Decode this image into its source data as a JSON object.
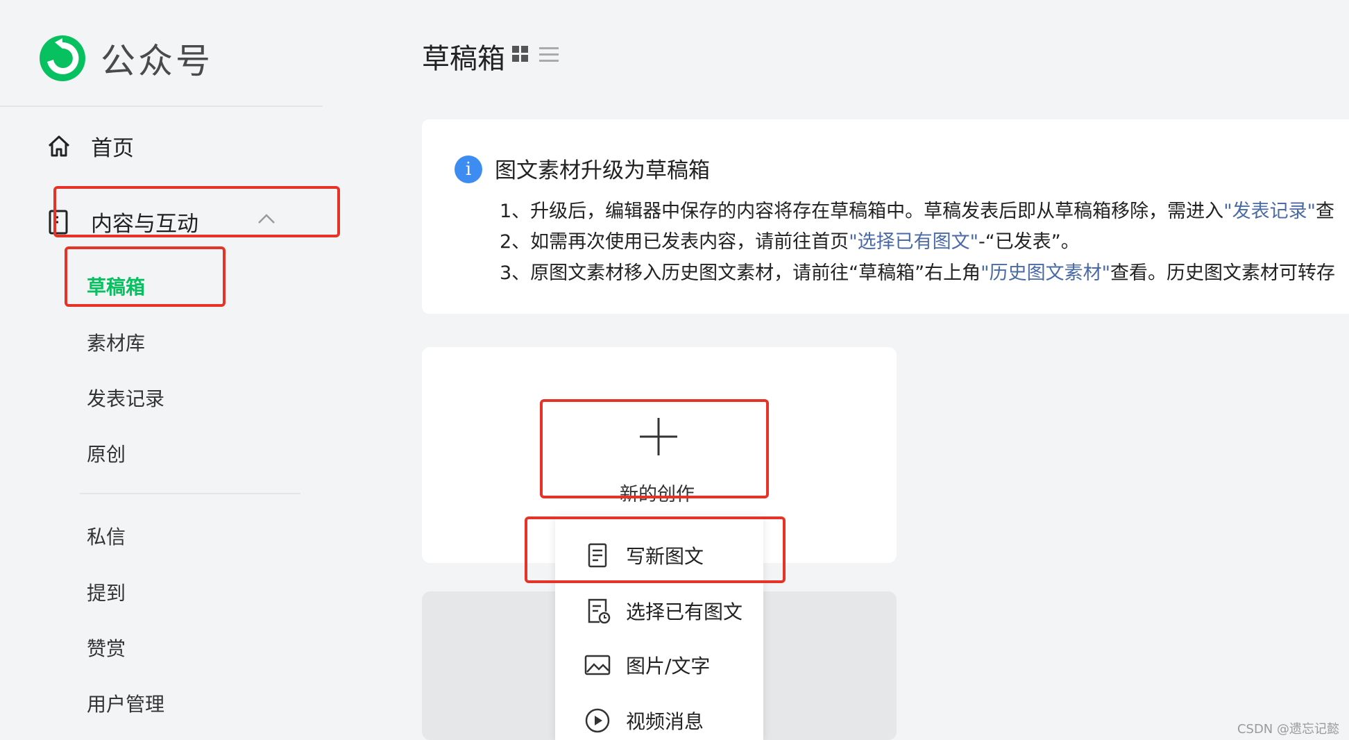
{
  "brand": {
    "name": "公众号",
    "logo_color": "#07c160"
  },
  "sidebar": {
    "home_label": "首页",
    "content_label": "内容与互动",
    "sub_items": [
      "草稿箱",
      "素材库",
      "发表记录",
      "原创"
    ],
    "interaction_items": [
      "私信",
      "提到",
      "赞赏",
      "用户管理"
    ]
  },
  "header": {
    "title": "草稿箱"
  },
  "notice": {
    "title": "图文素材升级为草稿箱",
    "line1_a": "1、升级后，编辑器中保存的内容将存在草稿箱中。草稿发表后即从草稿箱移除，需进入",
    "line1_link": "\"发表记录\"",
    "line1_b": "查",
    "line2_a": "2、如需再次使用已发表内容，请前往首页",
    "line2_link": "\"选择已有图文\"",
    "line2_b": "-“已发表”。",
    "line3_a": "3、原图文素材移入历史图文素材，请前往“草稿箱”右上角",
    "line3_link": "\"历史图文素材\"",
    "line3_b": "查看。历史图文素材可转存"
  },
  "create": {
    "label": "新的创作",
    "menu": [
      "写新图文",
      "选择已有图文",
      "图片/文字",
      "视频消息"
    ]
  },
  "watermark": "CSDN @遗忘记懿",
  "colors": {
    "accent": "#07c160",
    "highlight": "#e53327",
    "link": "#4a6aa6",
    "info": "#3d8cf2"
  }
}
